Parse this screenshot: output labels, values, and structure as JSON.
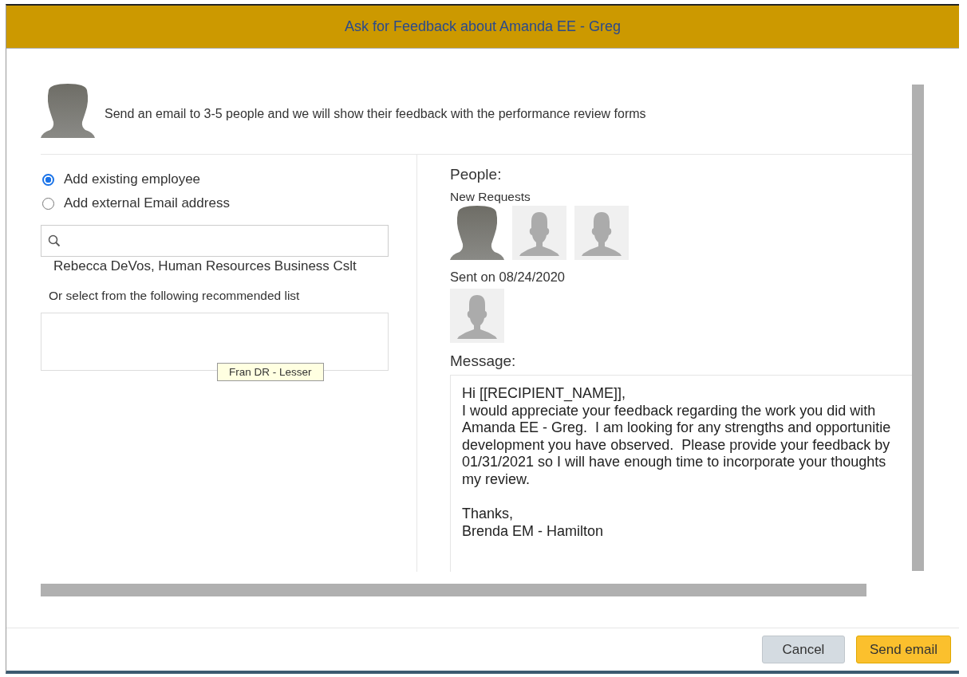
{
  "dialog": {
    "title": "Ask for Feedback about Amanda EE - Greg"
  },
  "intro": {
    "avatar": {
      "kind": "dark"
    },
    "text": "Send an email to 3-5 people and we will show their feedback with the performance review forms"
  },
  "add_options": [
    {
      "label": "Add existing employee",
      "selected": true
    },
    {
      "label": "Add external Email address",
      "selected": false
    }
  ],
  "search": {
    "suggestion": "Rebecca DeVos, Human Resources Business Cslt"
  },
  "recommended": {
    "label": "Or select from the following recommended list",
    "tooltip": "Fran DR - Lesser"
  },
  "people": {
    "title": "People:",
    "groups": [
      {
        "label": "New Requests",
        "avatars": [
          {
            "kind": "dark"
          },
          {
            "kind": "blank"
          },
          {
            "kind": "blank"
          }
        ]
      },
      {
        "label": "Sent on 08/24/2020",
        "avatars": [
          {
            "kind": "blank"
          }
        ]
      }
    ]
  },
  "message": {
    "title": "Message:",
    "paragraphs": [
      [
        "Hi [[RECIPIENT_NAME]],",
        "I would appreciate your feedback regarding the work you did with",
        "Amanda EE - Greg.  I am looking for any strengths and opportunitie",
        "development you have observed.  Please provide your feedback by",
        "01/31/2021 so I will have enough time to incorporate your thoughts",
        "my review."
      ],
      [
        "Thanks,",
        "Brenda EM - Hamilton"
      ]
    ]
  },
  "buttons": [
    {
      "label": "Cancel",
      "kind": "secondary"
    },
    {
      "label": "Send email",
      "kind": "primary"
    }
  ]
}
